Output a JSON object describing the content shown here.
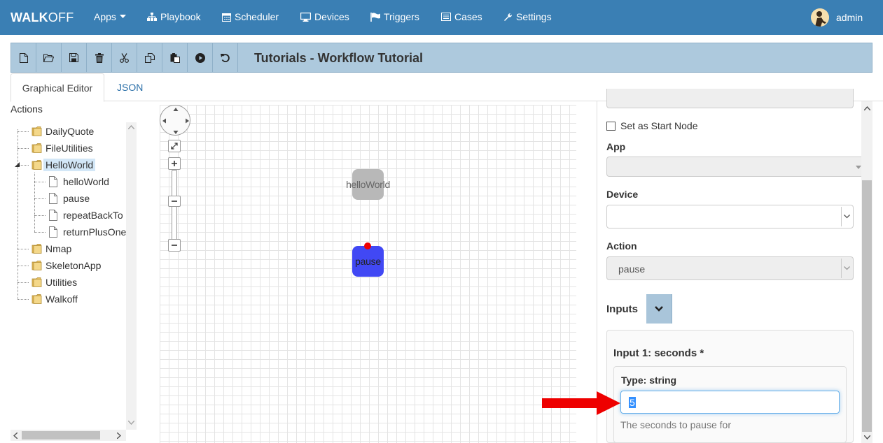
{
  "navbar": {
    "brand_bold": "WALK",
    "brand_rest": "OFF",
    "items": [
      {
        "label": "Apps",
        "icon": "caret-down-icon"
      },
      {
        "label": "Playbook",
        "icon": "sitemap-icon"
      },
      {
        "label": "Scheduler",
        "icon": "calendar-icon"
      },
      {
        "label": "Devices",
        "icon": "desktop-icon"
      },
      {
        "label": "Triggers",
        "icon": "flag-icon"
      },
      {
        "label": "Cases",
        "icon": "list-icon"
      },
      {
        "label": "Settings",
        "icon": "wrench-icon"
      }
    ],
    "user": "admin"
  },
  "toolbar": {
    "buttons": [
      "new-file-icon",
      "open-folder-icon",
      "save-icon",
      "delete-icon",
      "cut-icon",
      "copy-icon",
      "paste-icon",
      "run-icon",
      "undo-icon"
    ],
    "title": "Tutorials - Workflow Tutorial"
  },
  "tabs": [
    "Graphical Editor",
    "JSON"
  ],
  "actions": {
    "title": "Actions",
    "tree": [
      {
        "label": "DailyQuote",
        "type": "folder"
      },
      {
        "label": "FileUtilities",
        "type": "folder"
      },
      {
        "label": "HelloWorld",
        "type": "folder",
        "selected": true,
        "expanded": true
      },
      {
        "label": "helloWorld",
        "type": "file"
      },
      {
        "label": "pause",
        "type": "file"
      },
      {
        "label": "repeatBackTo",
        "type": "file"
      },
      {
        "label": "returnPlusOne",
        "type": "file"
      },
      {
        "label": "Nmap",
        "type": "folder"
      },
      {
        "label": "SkeletonApp",
        "type": "folder"
      },
      {
        "label": "Utilities",
        "type": "folder"
      },
      {
        "label": "Walkoff",
        "type": "folder"
      }
    ]
  },
  "canvas": {
    "nodes": [
      {
        "label": "helloWorld",
        "color": "#b8b8b8"
      },
      {
        "label": "pause",
        "color": "#4148f4",
        "is_start": true
      }
    ]
  },
  "properties": {
    "start_node_label": "Set as Start Node",
    "app_label": "App",
    "app_value": "",
    "device_label": "Device",
    "device_value": "",
    "action_label": "Action",
    "action_value": "pause",
    "inputs_label": "Inputs",
    "input1_title": "Input 1: seconds *",
    "input1_type": "Type: string",
    "input1_value": "5",
    "input1_help": "The seconds to pause for"
  },
  "colors": {
    "navbar": "#3a7fb4",
    "toolbar": "#adc9dd",
    "start_marker": "#e00000",
    "annotation_arrow": "#ee0000"
  }
}
